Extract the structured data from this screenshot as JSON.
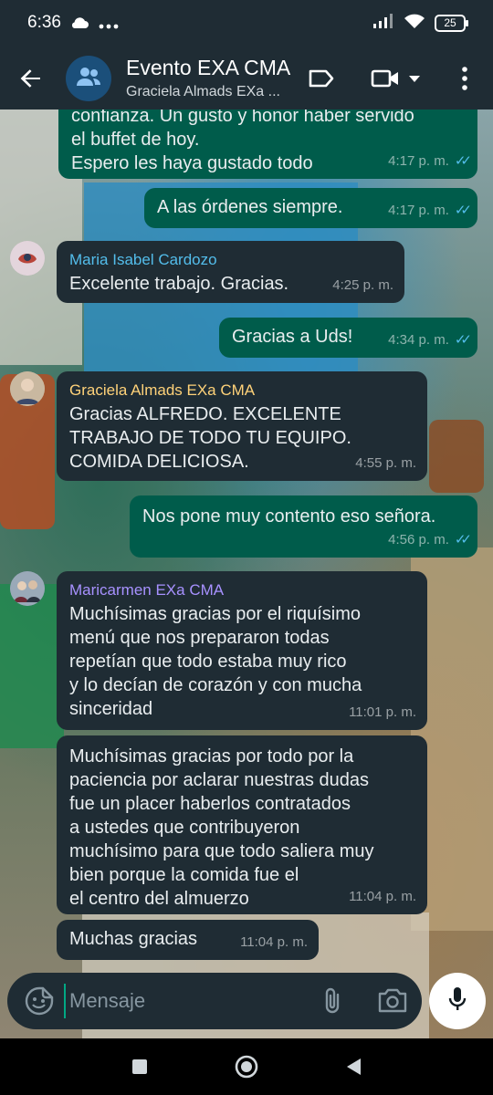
{
  "status_bar": {
    "time": "6:36",
    "left_icons": [
      "cloud-icon",
      "more-dots-icon"
    ],
    "right_icons": [
      "signal-icon",
      "wifi-icon"
    ],
    "battery": "25"
  },
  "header": {
    "title": "Evento EXA CMA",
    "subtitle": "Graciela Almads EXa ...",
    "icons": [
      "back-arrow-icon",
      "group-icon",
      "label-icon",
      "video-call-icon",
      "dropdown-icon",
      "more-vert-icon"
    ]
  },
  "messages": [
    {
      "direction": "out",
      "text_lines": [
        "confianza. Un gusto y honor haber servido",
        "el buffet de hoy.",
        "Espero les haya gustado todo"
      ],
      "time": "4:17 p. m.",
      "read": true
    },
    {
      "direction": "out",
      "text_lines": [
        "A las órdenes siempre."
      ],
      "time": "4:17 p. m.",
      "read": true
    },
    {
      "direction": "in",
      "sender": "Maria Isabel Cardozo",
      "sender_color": "#53bdeb",
      "text_lines": [
        "Excelente trabajo. Gracias."
      ],
      "time": "4:25 p. m."
    },
    {
      "direction": "out",
      "text_lines": [
        "Gracias a Uds!"
      ],
      "time": "4:34 p. m.",
      "read": true
    },
    {
      "direction": "in",
      "sender": "Graciela Almads EXa CMA",
      "sender_color": "#ffd279",
      "text_lines": [
        "Gracias ALFREDO. EXCELENTE",
        "TRABAJO DE TODO TU EQUIPO.",
        "COMIDA DELICIOSA."
      ],
      "time": "4:55 p. m."
    },
    {
      "direction": "out",
      "text_lines": [
        "Nos pone muy contento eso señora."
      ],
      "time": "4:56 p. m.",
      "read": true
    },
    {
      "direction": "in",
      "sender": "Maricarmen EXa CMA",
      "sender_color": "#a791ff",
      "text_lines": [
        "Muchísimas gracias por el riquísimo",
        "menú que nos prepararon todas",
        "repetían que todo estaba muy rico",
        "y lo decían de corazón y con mucha",
        "sinceridad"
      ],
      "time": "11:01 p. m."
    },
    {
      "direction": "in",
      "text_lines": [
        "Muchísimas gracias por todo por la",
        "paciencia por aclarar nuestras dudas",
        "fue un placer haberlos contratados",
        "a ustedes  que contribuyeron",
        "muchísimo para que todo saliera muy",
        "bien porque  la comida fue el",
        "el centro del almuerzo"
      ],
      "time": "11:04 p. m."
    },
    {
      "direction": "in",
      "text_lines": [
        "Muchas gracias"
      ],
      "time": "11:04 p. m."
    }
  ],
  "composer": {
    "placeholder": "Mensaje",
    "icons": [
      "emoji-sticker-icon",
      "attach-clip-icon",
      "camera-icon",
      "mic-icon"
    ]
  },
  "nav_bar": {
    "icons": [
      "recents-square-icon",
      "home-circle-icon",
      "back-triangle-icon"
    ]
  }
}
